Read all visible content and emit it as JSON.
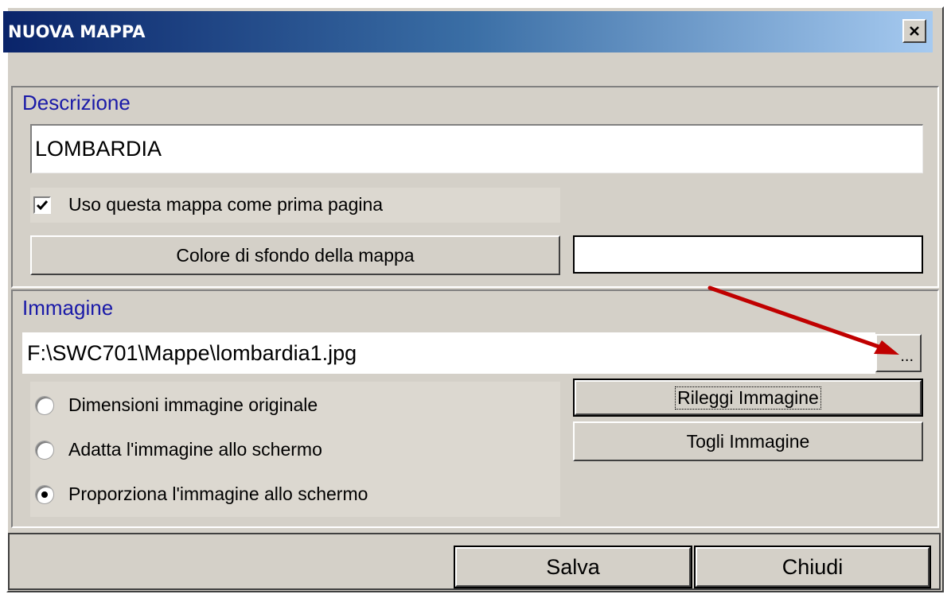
{
  "window": {
    "title": "NUOVA MAPPA",
    "close_label": "×"
  },
  "descrizione": {
    "section_label": "Descrizione",
    "value": "LOMBARDIA",
    "first_page_checkbox_label": "Uso questa mappa come prima pagina",
    "first_page_checked": true,
    "bg_color_button_label": "Colore di sfondo della mappa",
    "bg_color_value": "#ffffff"
  },
  "immagine": {
    "section_label": "Immagine",
    "path_value": "F:\\SWC701\\Mappe\\lombardia1.jpg",
    "browse_label": "...",
    "reload_label": "Rileggi Immagine",
    "remove_label": "Togli Immagine",
    "options": [
      {
        "label": "Dimensioni immagine originale",
        "selected": false
      },
      {
        "label": "Adatta l'immagine allo schermo",
        "selected": false
      },
      {
        "label": "Proporziona l'immagine allo schermo",
        "selected": true
      }
    ]
  },
  "footer": {
    "save_label": "Salva",
    "close_label": "Chiudi"
  },
  "colors": {
    "accent_blue": "#0a246a",
    "section_label_color": "#1a1aa8",
    "arrow_color": "#c00000"
  }
}
